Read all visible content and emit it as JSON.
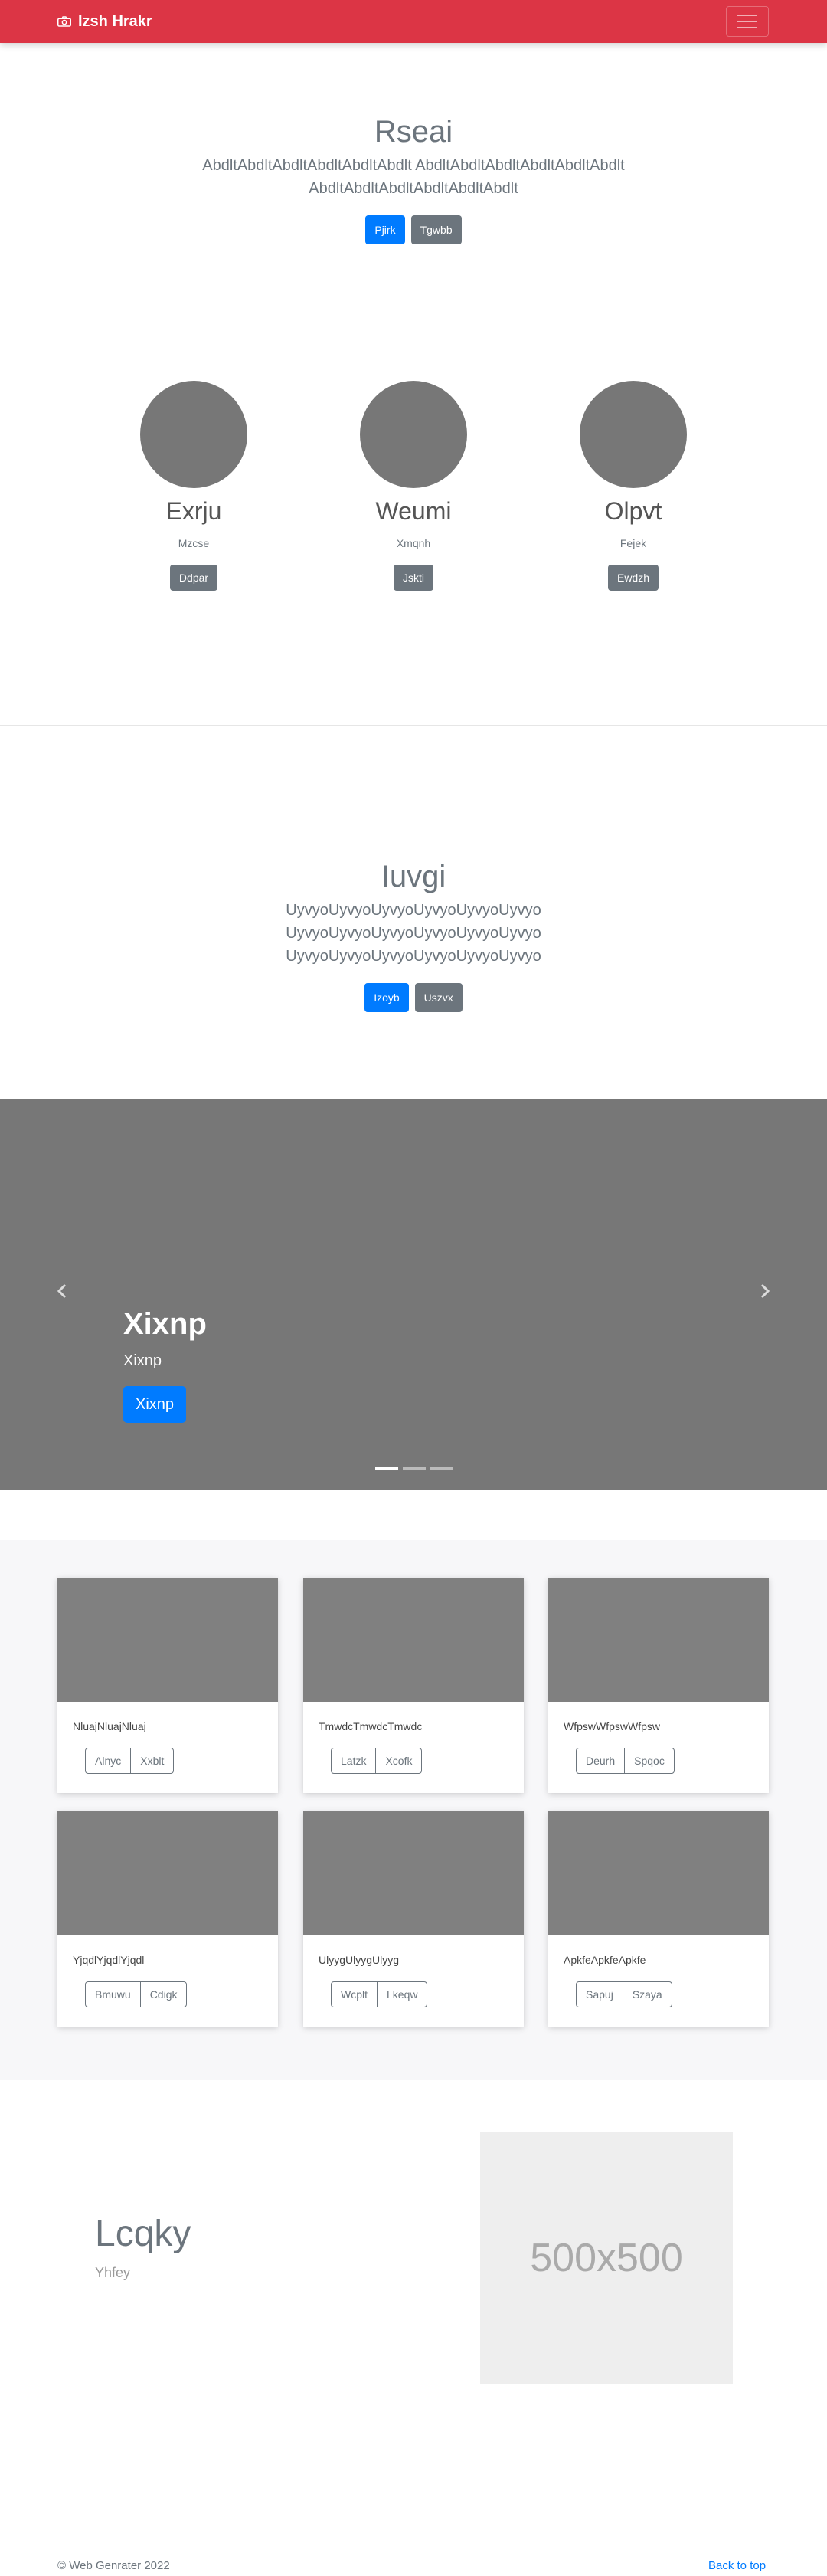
{
  "navbar": {
    "brand": "Izsh Hrakr",
    "brand_icon": "camera-icon",
    "toggler_icon": "hamburger-icon",
    "color": "#dc3545"
  },
  "hero": {
    "title": "Rseai",
    "lead_line1": "AbdltAbdltAbdltAbdltAbdltAbdlt AbdltAbdltAbdltAbdltAbdltAbdlt",
    "lead_line2": "AbdltAbdltAbdltAbdltAbdltAbdlt",
    "primary_button": "Pjirk",
    "secondary_button": "Tgwbb"
  },
  "team": [
    {
      "name": "Exrju",
      "role": "Mzcse",
      "button": "Ddpar"
    },
    {
      "name": "Weumi",
      "role": "Xmqnh",
      "button": "Jskti"
    },
    {
      "name": "Olpvt",
      "role": "Fejek",
      "button": "Ewdzh"
    }
  ],
  "section2": {
    "title": "Iuvgi",
    "lead_line1": "UyvyoUyvyoUyvyoUyvyoUyvyoUyvyo",
    "lead_line2": "UyvyoUyvyoUyvyoUyvyoUyvyoUyvyo",
    "lead_line3": "UyvyoUyvyoUyvyoUyvyoUyvyoUyvyo",
    "primary_button": "Izoyb",
    "secondary_button": "Uszvx"
  },
  "carousel": {
    "title": "Xixnp",
    "subtitle": "Xixnp",
    "button": "Xixnp",
    "slide_count": 3,
    "active_slide": 1
  },
  "albums": [
    {
      "text": "NluajNluajNluaj",
      "btn1": "Alnyc",
      "btn2": "Xxblt"
    },
    {
      "text": "TmwdcTmwdcTmwdc",
      "btn1": "Latzk",
      "btn2": "Xcofk"
    },
    {
      "text": "WfpswWfpswWfpsw",
      "btn1": "Deurh",
      "btn2": "Spqoc"
    },
    {
      "text": "YjqdlYjqdlYjqdl",
      "btn1": "Bmuwu",
      "btn2": "Cdigk"
    },
    {
      "text": "UlyygUlyygUlyyg",
      "btn1": "Wcplt",
      "btn2": "Lkeqw"
    },
    {
      "text": "ApkfeApkfeApkfe",
      "btn1": "Sapuj",
      "btn2": "Szaya"
    }
  ],
  "feature": {
    "title": "Lcqky",
    "subtitle": "Yhfey",
    "image_text": "500x500"
  },
  "footer": {
    "copyright": "© Web Genrater 2022",
    "back_to_top": "Back to top"
  }
}
